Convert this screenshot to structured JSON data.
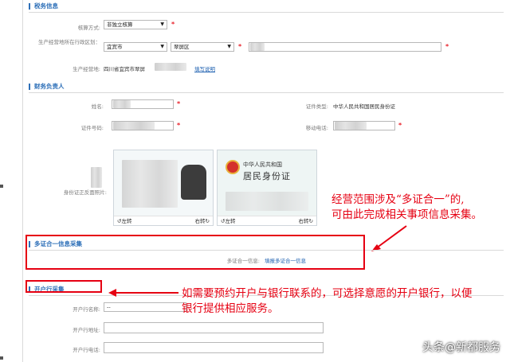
{
  "tax_section": {
    "title": "税务信息",
    "accounting_label": "核算方式:",
    "accounting_value": "非独立核算",
    "location_label": "生产经营地所在行政区划：",
    "city_value": "宜宾市",
    "district_value": "翠屏区",
    "address_label": "生产经营地:",
    "address_value": "四川省宜宾市翠屏",
    "fill_hint": "填写说明"
  },
  "finance_section": {
    "title": "财务负责人",
    "name_label": "姓名:",
    "id_type_label": "证件类型:",
    "id_type_value": "中华人民共和国居民身份证",
    "id_no_label": "证件号码:",
    "mobile_label": "移动电话:",
    "id_photo_label": "身份证正反面照片:",
    "card_back_lines": [
      "中华人民共和国",
      "居民身份证"
    ],
    "rotate_left": "左转",
    "rotate_right": "右转"
  },
  "multi_cert_section": {
    "title": "多证合一信息采集",
    "info_label": "多证合一信息:",
    "info_link": "填报多证合一信息"
  },
  "bank_section": {
    "title": "开户行采集",
    "bank_name_label": "开户行名称:",
    "bank_name_value": "--",
    "bank_addr_label": "开户行地址:",
    "bank_phone_label": "开户行电话:"
  },
  "annotations": {
    "note1": [
      "经营范围涉及“多证合一”的,",
      "可由此完成相关事项信息采集。"
    ],
    "note2": [
      "如需要预约开户与银行联系的，可选择意愿的开户银行，以便",
      "银行提供相应服务。"
    ]
  },
  "watermark": "头条@新都服务",
  "colors": {
    "accent": "#2d6fb8",
    "annotation": "#e60012",
    "required": "#e8202a"
  },
  "icons": [
    "rotate-left-icon",
    "rotate-right-icon",
    "national-emblem-icon",
    "dropdown-arrow-icon"
  ]
}
